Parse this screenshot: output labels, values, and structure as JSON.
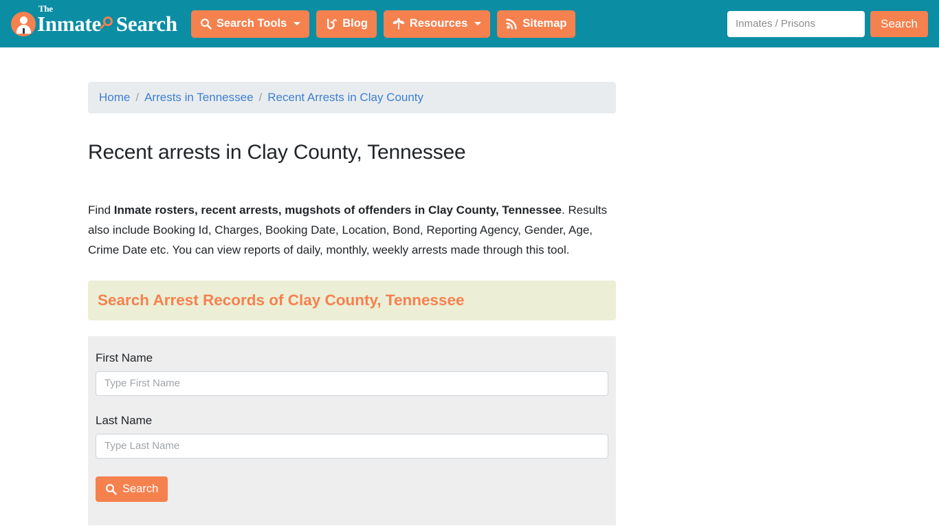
{
  "theme": {
    "header_bg": "#0b8da4",
    "accent_orange": "#f5814f",
    "breadcrumb_bg": "#e9ecef",
    "section_head_bg": "#ecefd6",
    "form_panel_bg": "#eeeeee",
    "link_blue": "#3c7fd0"
  },
  "header": {
    "logo": {
      "the": "The",
      "inmate": "Inmate",
      "search": "Search",
      "person_icon": "person-icon",
      "magnifier_icon": "magnifier-icon"
    },
    "nav": [
      {
        "label": "Search Tools",
        "icon": "magnifier-icon",
        "has_caret": true
      },
      {
        "label": "Blog",
        "icon": "blogger-icon",
        "has_caret": false
      },
      {
        "label": "Resources",
        "icon": "seedling-icon",
        "has_caret": true
      },
      {
        "label": "Sitemap",
        "icon": "rss-icon",
        "has_caret": false
      }
    ],
    "search": {
      "placeholder": "Inmates / Prisons",
      "value": "",
      "button_label": "Search"
    }
  },
  "breadcrumb": {
    "items": [
      "Home",
      "Arrests in Tennessee",
      "Recent Arrests in Clay County"
    ],
    "separator": "/"
  },
  "main": {
    "title": "Recent arrests in Clay County, Tennessee",
    "intro": {
      "lead": "Find ",
      "bold": "Inmate rosters, recent arrests, mugshots of offenders in Clay County, Tennessee",
      "rest": ". Results also include Booking Id, Charges, Booking Date, Location, Bond, Reporting Agency, Gender, Age, Crime Date etc. You can view reports of daily, monthly, weekly arrests made through this tool."
    },
    "section_heading": "Search Arrest Records of Clay County, Tennessee",
    "form": {
      "first_name": {
        "label": "First Name",
        "placeholder": "Type First Name",
        "value": ""
      },
      "last_name": {
        "label": "Last Name",
        "placeholder": "Type Last Name",
        "value": ""
      },
      "submit_label": "Search",
      "submit_icon": "magnifier-icon"
    }
  }
}
